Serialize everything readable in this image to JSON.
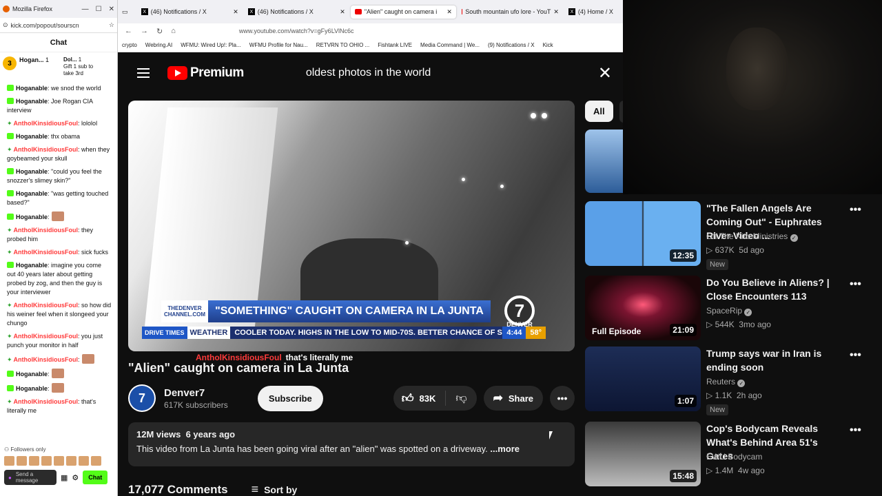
{
  "chat_window": {
    "browser_title": "Mozilla Firefox",
    "url": "kick.com/popout/sourscn",
    "header": "Chat",
    "pinned": {
      "coin_count": "3",
      "user": "Hogan...",
      "user_count": "1",
      "donor": "Dol...",
      "donor_count": "1",
      "gift_text": "Gift 1 sub to take 3rd"
    },
    "messages": [
      {
        "user": "Hoganable",
        "text": ": we snod the world",
        "color": "u1"
      },
      {
        "user": "Hoganable",
        "text": ": Joe Rogan CIA interview",
        "color": "u1"
      },
      {
        "user": "AntholKinsidiousFoul",
        "text": ": lololol",
        "color": "u2"
      },
      {
        "user": "Hoganable",
        "text": ": thx obama",
        "color": "u1"
      },
      {
        "user": "AntholKinsidiousFoul",
        "text": ": when they goybeamed your skull",
        "color": "u2"
      },
      {
        "user": "Hoganable",
        "text": ": \"could you feel the snozzer's slimey skin?\"",
        "color": "u1"
      },
      {
        "user": "Hoganable",
        "text": ": \"was getting touched based?\"",
        "color": "u1"
      },
      {
        "user": "Hoganable",
        "text": ":",
        "color": "u1",
        "emote": true
      },
      {
        "user": "AntholKinsidiousFoul",
        "text": ": they probed him",
        "color": "u2"
      },
      {
        "user": "AntholKinsidiousFoul",
        "text": ": sick fucks",
        "color": "u2"
      },
      {
        "user": "Hoganable",
        "text": ": imagine you come out 40 years later about getting probed by zog, and then the guy is your interviewer",
        "color": "u1"
      },
      {
        "user": "AntholKinsidiousFoul",
        "text": ": so how did his weiner feel when it slongeed your chungo",
        "color": "u2"
      },
      {
        "user": "AntholKinsidiousFoul",
        "text": ": you just punch your monitor in half",
        "color": "u2"
      },
      {
        "user": "AntholKinsidiousFoul",
        "text": ":",
        "color": "u2",
        "emote": true
      },
      {
        "user": "Hoganable",
        "text": ":",
        "color": "u1",
        "emote": true
      },
      {
        "user": "Hoganable",
        "text": ":",
        "color": "u1",
        "emote": true
      },
      {
        "user": "AntholKinsidiousFoul",
        "text": ": that's literally me",
        "color": "u2"
      }
    ],
    "followers_only": "Followers only",
    "send_placeholder": "Send a message",
    "chat_button": "Chat"
  },
  "browser": {
    "tabs": [
      {
        "label": "(46) Notifications / X",
        "icon": "x-logo-icon"
      },
      {
        "label": "(46) Notifications / X",
        "icon": "x-logo-icon"
      },
      {
        "label": "\"Alien\" caught on camera i",
        "icon": "youtube-icon",
        "active": true
      },
      {
        "label": "South mountain ufo lore - YouT",
        "icon": "youtube-icon"
      },
      {
        "label": "(4) Home / X",
        "icon": "x-logo-icon"
      }
    ],
    "url": "www.youtube.com/watch?v=gFy6LVlNc6c",
    "bookmarks": [
      "crypto",
      "Webring.AI",
      "WFMU: Wired Up!: Pla...",
      "WFMU Profile for Nau...",
      "RETVRN TO OHIO ...",
      "Fishtank LIVE",
      "Media Command | We...",
      "(9) Notifications / X",
      "Kick"
    ]
  },
  "youtube": {
    "logo_text": "Premium",
    "search_value": "oldest photos in the world",
    "video": {
      "banner_station": "THEDENVER CHANNEL.COM",
      "banner_headline": "\"SOMETHING\" CAUGHT ON CAMERA IN LA JUNTA",
      "ticker_label1": "DRIVE TIMES",
      "ticker_label2": "WEATHER",
      "ticker_text": "COOLER TODAY. HIGHS IN THE LOW TO MID-70S. BETTER CHANCE OF STOR",
      "ticker_time": "4:44",
      "ticker_temp": "58°",
      "logo_number": "7",
      "logo_network": "DENVER"
    },
    "overlay_chat": {
      "name": "AntholKinsidiousFoul",
      "message": "that's literally me"
    },
    "title": "\"Alien\" caught on camera in La Junta",
    "channel": {
      "name": "Denver7",
      "subscribers": "617K subscribers",
      "avatar_text": "7"
    },
    "subscribe": "Subscribe",
    "likes": "83K",
    "share": "Share",
    "description": {
      "views": "12M views",
      "age": "6 years ago",
      "text": "This video from La Junta has been going viral after an \"alien\" was spotted on a driveway.",
      "more": "...more"
    },
    "comments": {
      "count": "17,077 Comments",
      "sort": "Sort by"
    },
    "chip_all": "All",
    "recommendations": [
      {
        "title": "\"The Fallen Angels Are Coming Out\" - Euphrates River Video ...",
        "channel": "Off The Kirb Ministries",
        "views": "637K",
        "age": "5d ago",
        "duration": "12:35",
        "badge": "New",
        "verified": true
      },
      {
        "title": "Do You Believe in Aliens? | Close Encounters 113",
        "channel": "SpaceRip",
        "views": "544K",
        "age": "3mo ago",
        "duration": "21:09",
        "episode": "Full Episode",
        "verified": true
      },
      {
        "title": "Trump says war in Iran is ending soon",
        "channel": "Reuters",
        "views": "1.1K",
        "age": "2h ago",
        "duration": "1:07",
        "badge": "New",
        "verified": true
      },
      {
        "title": "Cop's Bodycam Reveals What's Behind Area 51's Gates",
        "channel": "EWU Bodycam",
        "views": "1.4M",
        "age": "4w ago",
        "duration": "15:48",
        "verified": false
      }
    ]
  },
  "colors": {
    "yt_bg": "#0f0f0f",
    "kick_green": "#53fc18",
    "yt_red": "#ff0000"
  }
}
